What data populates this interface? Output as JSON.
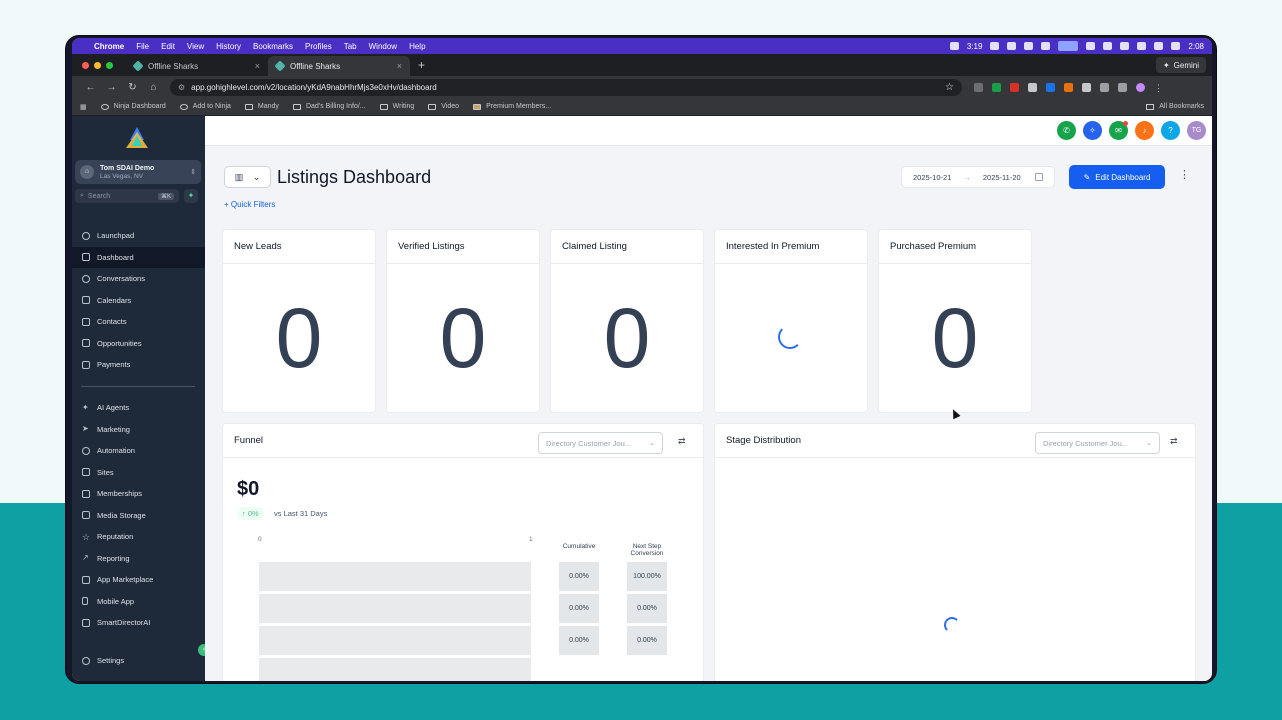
{
  "menubar": {
    "app": "Chrome",
    "items": [
      "File",
      "Edit",
      "View",
      "History",
      "Bookmarks",
      "Profiles",
      "Tab",
      "Window",
      "Help"
    ],
    "timer": "3:19",
    "clock": "2:08"
  },
  "browser": {
    "tabs": [
      {
        "title": "Offline Sharks",
        "close": "×"
      },
      {
        "title": "Offline Sharks",
        "close": "×"
      }
    ],
    "new_tab": "+",
    "gemini": "Gemini",
    "url": "app.gohighlevel.com/v2/location/yKdA9nabHhrMjs3e0xHv/dashboard",
    "bookmarks": [
      "Ninja Dashboard",
      "Add to Ninja",
      "Mandy",
      "Dad's Billing Info/...",
      "Writing",
      "Video",
      "Premium Members..."
    ],
    "all_bookmarks": "All Bookmarks"
  },
  "sidebar": {
    "account_name": "Tom SDAI Demo",
    "account_location": "Las Vegas, NV",
    "search_placeholder": "Search",
    "search_shortcut": "⌘K",
    "items_top": [
      "Launchpad",
      "Dashboard",
      "Conversations",
      "Calendars",
      "Contacts",
      "Opportunities",
      "Payments"
    ],
    "items_bottom": [
      "AI Agents",
      "Marketing",
      "Automation",
      "Sites",
      "Memberships",
      "Media Storage",
      "Reputation",
      "Reporting",
      "App Marketplace",
      "Mobile App",
      "SmartDirectorAI"
    ],
    "settings": "Settings",
    "active": "Dashboard"
  },
  "header": {
    "user_initials": "TG",
    "help": "?"
  },
  "dashboard": {
    "title": "Listings Dashboard",
    "date_start": "2025-10-21",
    "date_end": "2025-11-20",
    "edit_button": "Edit Dashboard",
    "quick_filters": "Quick Filters",
    "stats": [
      {
        "label": "New Leads",
        "value": "0"
      },
      {
        "label": "Verified Listings",
        "value": "0"
      },
      {
        "label": "Claimed Listing",
        "value": "0"
      },
      {
        "label": "Interested In Premium",
        "value": ""
      },
      {
        "label": "Purchased Premium",
        "value": "0"
      }
    ],
    "funnel": {
      "title": "Funnel",
      "dropdown": "Directory Customer Jou...",
      "total": "$0",
      "change": "0%",
      "comparison": "vs Last 31 Days",
      "axis_min": "0",
      "axis_max": "1",
      "col_cumulative": "Cumulative",
      "col_next_step": "Next Step Conversion",
      "rows": [
        {
          "cumulative": "0.00%",
          "next": "100.00%"
        },
        {
          "cumulative": "0.00%",
          "next": "0.00%"
        },
        {
          "cumulative": "0.00%",
          "next": "0.00%"
        }
      ]
    },
    "stage": {
      "title": "Stage Distribution",
      "dropdown": "Directory Customer Jou..."
    }
  },
  "colors": {
    "menubar": "#4a2fc4",
    "sidebar": "#1e2939",
    "primary": "#155eef",
    "background_teal": "#0fa0a4"
  }
}
